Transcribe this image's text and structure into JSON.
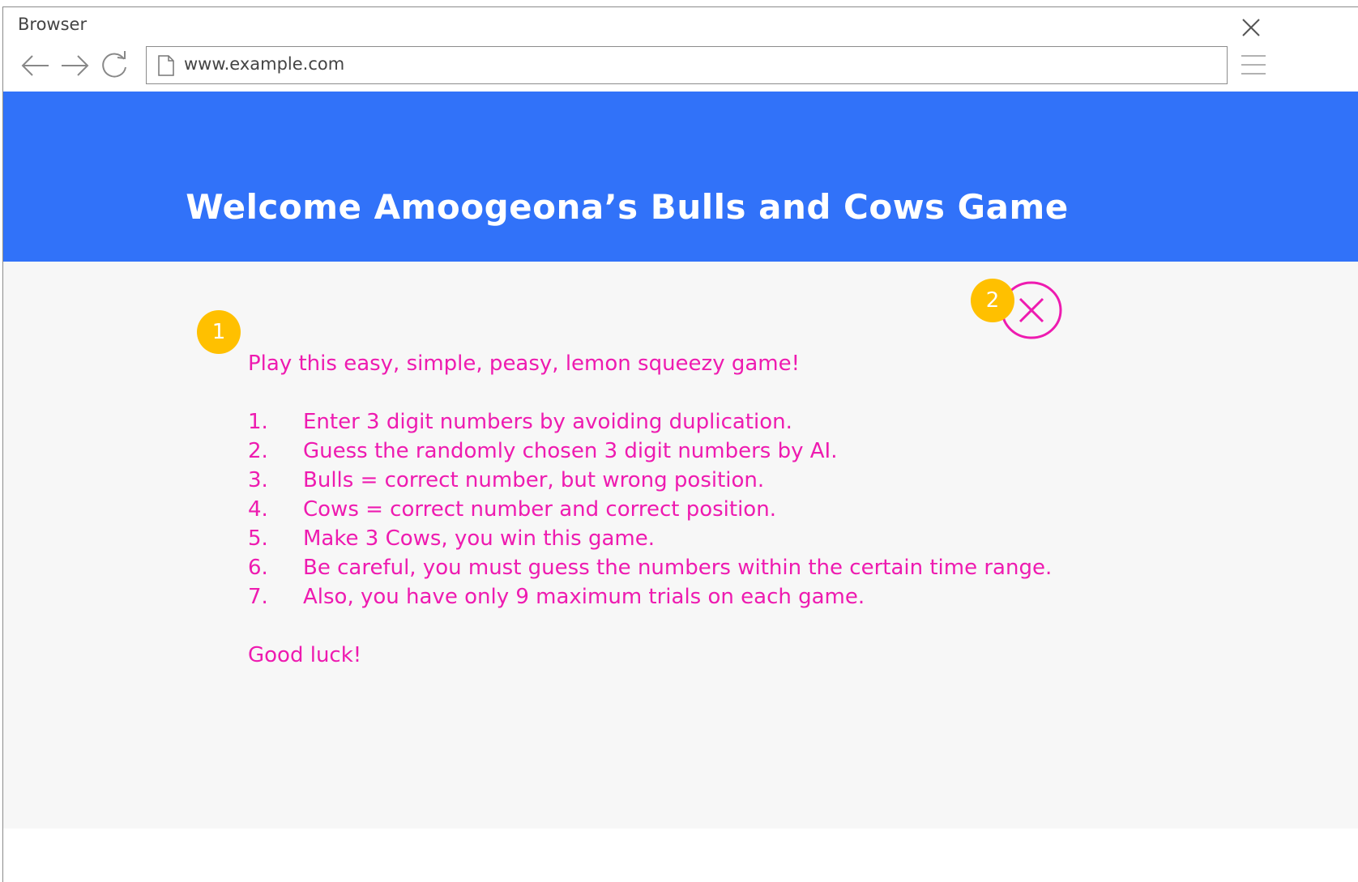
{
  "browser": {
    "title": "Browser",
    "url": "www.example.com"
  },
  "header": {
    "title": "Welcome Amoogeona’s Bulls and Cows Game",
    "background": "#3172f9"
  },
  "annotations": {
    "badge_1": "1",
    "badge_2": "2",
    "color": "#ffc000"
  },
  "instructions": {
    "intro": "Play this easy, simple, peasy, lemon squeezy game!",
    "rules": [
      {
        "num": "1.",
        "text": "Enter 3 digit numbers by avoiding duplication."
      },
      {
        "num": "2.",
        "text": "Guess the randomly chosen 3 digit numbers by AI."
      },
      {
        "num": "3.",
        "text": "Bulls = correct number, but wrong position."
      },
      {
        "num": "4.",
        "text": "Cows = correct number and correct position."
      },
      {
        "num": "5.",
        "text": "Make 3 Cows, you win this game."
      },
      {
        "num": "6.",
        "text": "Be careful, you must guess the numbers within the certain time range."
      },
      {
        "num": "7.",
        "text": "Also, you have only 9 maximum trials on each game."
      }
    ],
    "outro": "Good luck!",
    "color": "#ee1bb0"
  },
  "icons": {
    "window_close": "close-icon",
    "back": "arrow-left-icon",
    "forward": "arrow-right-icon",
    "reload": "reload-icon",
    "page": "page-icon",
    "menu": "hamburger-menu-icon",
    "dialog_close": "circle-close-icon"
  }
}
